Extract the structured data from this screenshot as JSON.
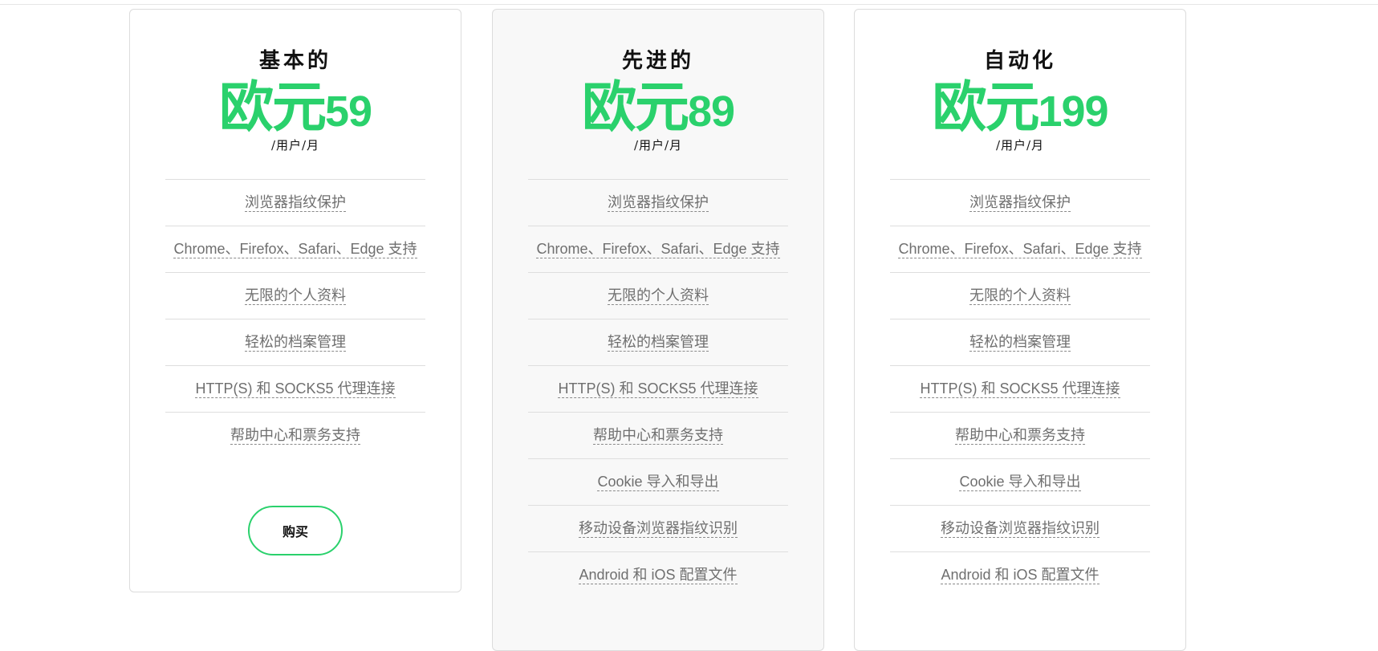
{
  "plans": [
    {
      "name": "基本的",
      "price_currency": "欧元",
      "price_amount": "59",
      "period": "/用户/月",
      "features": [
        "浏览器指纹保护",
        "Chrome、Firefox、Safari、Edge 支持",
        "无限的个人资料",
        "轻松的档案管理",
        "HTTP(S) 和 SOCKS5 代理连接",
        "帮助中心和票务支持"
      ],
      "buy_label": "购买"
    },
    {
      "name": "先进的",
      "price_currency": "欧元",
      "price_amount": "89",
      "period": "/用户/月",
      "features": [
        "浏览器指纹保护",
        "Chrome、Firefox、Safari、Edge 支持",
        "无限的个人资料",
        "轻松的档案管理",
        "HTTP(S) 和 SOCKS5 代理连接",
        "帮助中心和票务支持",
        "Cookie 导入和导出",
        "移动设备浏览器指纹识别",
        "Android 和 iOS 配置文件"
      ]
    },
    {
      "name": "自动化",
      "price_currency": "欧元",
      "price_amount": "199",
      "period": "/用户/月",
      "features": [
        "浏览器指纹保护",
        "Chrome、Firefox、Safari、Edge 支持",
        "无限的个人资料",
        "轻松的档案管理",
        "HTTP(S) 和 SOCKS5 代理连接",
        "帮助中心和票务支持",
        "Cookie 导入和导出",
        "移动设备浏览器指纹识别",
        "Android 和 iOS 配置文件"
      ]
    }
  ],
  "colors": {
    "accent": "#2ad16c",
    "featured_background": "#f8f8f8",
    "border": "#dcdcdc"
  }
}
